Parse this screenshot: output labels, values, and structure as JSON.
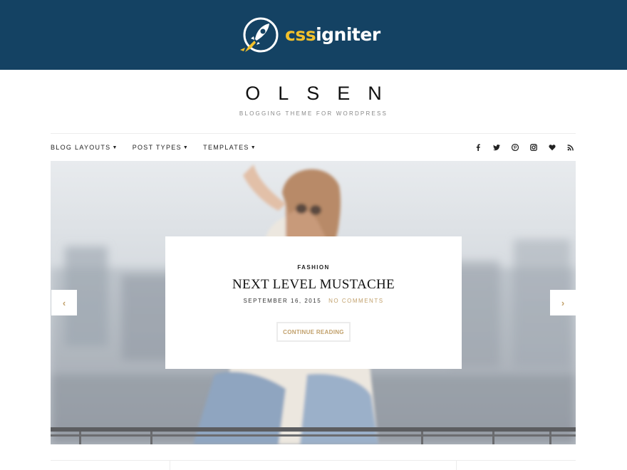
{
  "brand": {
    "name_part1": "css",
    "name_part2": "igniter",
    "logo_icon": "rocket-icon",
    "background_color": "#144263",
    "accent_color": "#f3c12b"
  },
  "site": {
    "title": "OLSEN",
    "tagline": "BLOGGING THEME FOR WORDPRESS"
  },
  "nav": {
    "items": [
      {
        "label": "BLOG LAYOUTS",
        "icon": "chevron-down-icon"
      },
      {
        "label": "POST TYPES",
        "icon": "chevron-down-icon"
      },
      {
        "label": "TEMPLATES",
        "icon": "chevron-down-icon"
      }
    ]
  },
  "social": {
    "icons": [
      "facebook-icon",
      "twitter-icon",
      "pinterest-icon",
      "instagram-icon",
      "heart-icon",
      "rss-icon"
    ]
  },
  "slide": {
    "category": "FASHION",
    "title": "NEXT LEVEL MUSTACHE",
    "date": "SEPTEMBER 16, 2015",
    "comments": "NO COMMENTS",
    "button_label": "CONTINUE READING",
    "accent_color": "#c1a06b"
  },
  "slider": {
    "prev_icon": "chevron-left-icon",
    "next_icon": "chevron-right-icon",
    "prev_glyph": "‹",
    "next_glyph": "›"
  }
}
